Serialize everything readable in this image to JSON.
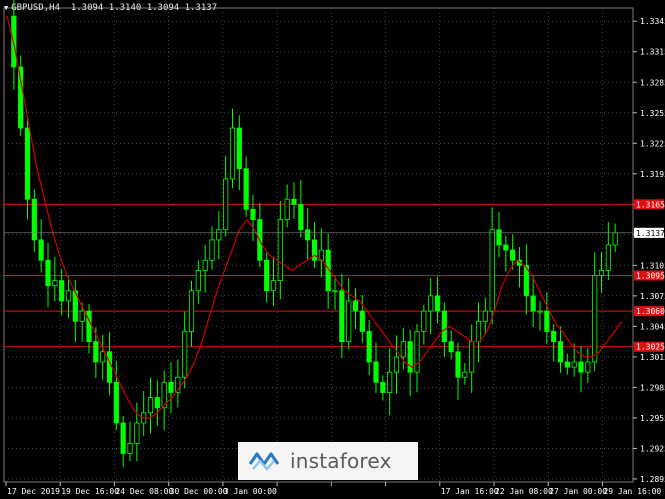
{
  "header": {
    "symbol_timeframe": "GBPUSD,H4",
    "ohlc": "1.3094 1.3140 1.3094 1.3137"
  },
  "colors": {
    "background": "#000000",
    "candle": "#00ff00",
    "moving_average": "#d00000",
    "level_line": "#e01010",
    "grid": "#6a6a6a",
    "text": "#ffffff",
    "current_price_marker": "#ffffff"
  },
  "watermark": {
    "text": "instaforex",
    "icon": "instaforex-logo-icon"
  },
  "chart_data": {
    "type": "candlestick",
    "title": "GBPUSD,H4",
    "timeframe": "H4",
    "ylim": [
      1.2892,
      1.3358
    ],
    "grid": "dotted",
    "y_ticks": [
      "1.3345",
      "1.3315",
      "1.3285",
      "1.3255",
      "1.3225",
      "1.3195",
      "1.3165",
      "1.3135",
      "1.3105",
      "1.3075",
      "1.3045",
      "1.3015",
      "1.2985",
      "1.2955",
      "1.2925",
      "1.2895"
    ],
    "x_ticks": [
      "17 Dec 2019",
      "19 Dec 16:00",
      "24 Dec 08:00",
      "30 Dec 00:00",
      "3 Jan 00:00",
      "",
      "",
      "",
      "17 Jan 16:00",
      "22 Jan 08:00",
      "27 Jan 00:00",
      "29 Jan 16:00"
    ],
    "current_price": "1.3137",
    "levels": [
      {
        "label": "1.3165",
        "value": 1.3165
      },
      {
        "label": "1.3095",
        "value": 1.3095
      },
      {
        "label": "1.3060",
        "value": 1.306
      },
      {
        "label": "1.3025",
        "value": 1.3025
      }
    ],
    "close_path": [
      1.335,
      1.33,
      1.324,
      1.317,
      1.313,
      1.311,
      1.3085,
      1.309,
      1.307,
      1.308,
      1.305,
      1.306,
      1.303,
      1.301,
      1.302,
      1.299,
      1.295,
      1.292,
      1.293,
      1.295,
      1.296,
      1.2975,
      1.2965,
      1.299,
      1.298,
      1.2995,
      1.304,
      1.308,
      1.31,
      1.311,
      1.313,
      1.314,
      1.319,
      1.324,
      1.32,
      1.316,
      1.315,
      1.311,
      1.308,
      1.309,
      1.315,
      1.317,
      1.3165,
      1.314,
      1.313,
      1.311,
      1.312,
      1.308,
      1.308,
      1.303,
      1.307,
      1.306,
      1.304,
      1.301,
      1.299,
      1.298,
      1.3,
      1.3015,
      1.303,
      1.3,
      1.304,
      1.306,
      1.3075,
      1.306,
      1.303,
      1.302,
      1.2995,
      1.3,
      1.303,
      1.305,
      1.306,
      1.314,
      1.3125,
      1.312,
      1.311,
      1.3105,
      1.3075,
      1.306,
      1.306,
      1.304,
      1.303,
      1.301,
      1.3005,
      1.301,
      1.3,
      1.301,
      1.3095,
      1.31,
      1.3125,
      1.3137
    ],
    "ma_path": [
      1.335,
      1.332,
      1.328,
      1.324,
      1.32,
      1.317,
      1.314,
      1.3115,
      1.3095,
      1.308,
      1.3065,
      1.305,
      1.3035,
      1.302,
      1.3005,
      1.299,
      1.2975,
      1.2962,
      1.2955,
      1.2955,
      1.296,
      1.2968,
      1.2975,
      1.2985,
      1.2995,
      1.301,
      1.303,
      1.3055,
      1.308,
      1.31,
      1.312,
      1.314,
      1.315,
      1.314,
      1.3125,
      1.3115,
      1.311,
      1.3105,
      1.31,
      1.3105,
      1.311,
      1.3115,
      1.311,
      1.31,
      1.309,
      1.308,
      1.3075,
      1.307,
      1.306,
      1.305,
      1.304,
      1.303,
      1.302,
      1.301,
      1.3005,
      1.301,
      1.302,
      1.303,
      1.304,
      1.3045,
      1.304,
      1.3035,
      1.303,
      1.303,
      1.304,
      1.306,
      1.3085,
      1.31,
      1.311,
      1.3105,
      1.3095,
      1.308,
      1.3065,
      1.305,
      1.304,
      1.303,
      1.302,
      1.3015,
      1.3015,
      1.302,
      1.303,
      1.304,
      1.305
    ]
  }
}
